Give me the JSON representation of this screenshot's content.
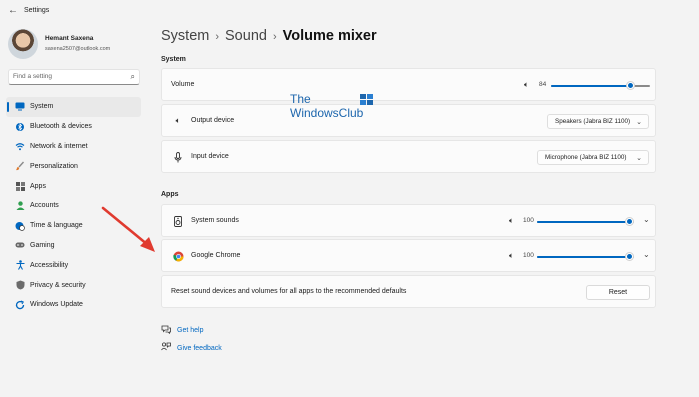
{
  "window": {
    "title": "Settings"
  },
  "profile": {
    "name": "Hemant Saxena",
    "email": "saxena2507@outlook.com"
  },
  "search": {
    "placeholder": "Find a setting"
  },
  "nav": [
    {
      "label": "System",
      "icon": "monitor-icon",
      "color": "#0067c0"
    },
    {
      "label": "Bluetooth & devices",
      "icon": "bluetooth-icon",
      "color": "#0067c0"
    },
    {
      "label": "Network & internet",
      "icon": "wifi-icon",
      "color": "#0067c0"
    },
    {
      "label": "Personalization",
      "icon": "brush-icon",
      "color": "#e07a2e"
    },
    {
      "label": "Apps",
      "icon": "apps-icon",
      "color": "#444"
    },
    {
      "label": "Accounts",
      "icon": "person-icon",
      "color": "#2f9e4f"
    },
    {
      "label": "Time & language",
      "icon": "globe-clock-icon",
      "color": "#0067c0"
    },
    {
      "label": "Gaming",
      "icon": "gamepad-icon",
      "color": "#555"
    },
    {
      "label": "Accessibility",
      "icon": "accessibility-icon",
      "color": "#0067c0"
    },
    {
      "label": "Privacy & security",
      "icon": "shield-icon",
      "color": "#555"
    },
    {
      "label": "Windows Update",
      "icon": "update-icon",
      "color": "#0067c0"
    }
  ],
  "breadcrumb": {
    "part1": "System",
    "part2": "Sound",
    "current": "Volume mixer"
  },
  "sections": {
    "system": "System",
    "apps": "Apps"
  },
  "system": {
    "volume": {
      "label": "Volume",
      "value": "84",
      "level": 0.84
    },
    "output": {
      "label": "Output device",
      "value": "Speakers (Jabra BIZ 1100)"
    },
    "input": {
      "label": "Input device",
      "value": "Microphone (Jabra BIZ 1100)"
    }
  },
  "apps": [
    {
      "label": "System sounds",
      "value": "100",
      "level": 1.0
    },
    {
      "label": "Google Chrome",
      "value": "100",
      "level": 1.0
    }
  ],
  "reset": {
    "text": "Reset sound devices and volumes for all apps to the recommended defaults",
    "button": "Reset"
  },
  "links": {
    "help": "Get help",
    "feedback": "Give feedback"
  },
  "watermark": {
    "line1": "The",
    "line2": "WindowsClub"
  },
  "colors": {
    "accent": "#0067c0",
    "annotation": "#e03a2f"
  }
}
